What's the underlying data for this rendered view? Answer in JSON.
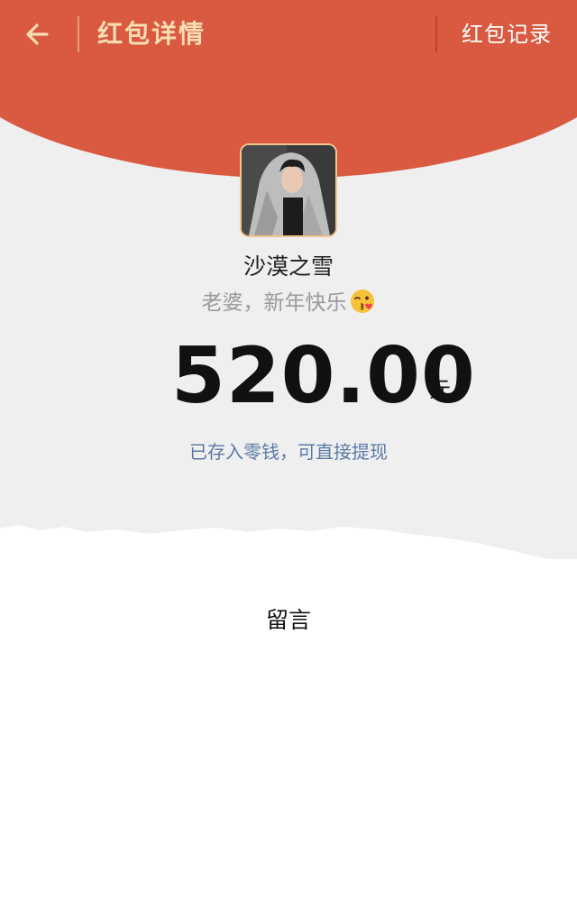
{
  "header": {
    "back_icon": "arrow-left-icon",
    "title": "红包详情",
    "records_label": "红包记录"
  },
  "sender": {
    "name": "沙漠之雪",
    "greeting": "老婆，新年快乐",
    "greeting_emoji": "kissing-face-wink-icon"
  },
  "amount": {
    "value": "520.00",
    "currency": "元"
  },
  "storage_note": "已存入零钱，可直接提现",
  "comment": {
    "label": "留言"
  },
  "colors": {
    "header_red": "#d95a40",
    "title_gold": "#f8ddb2",
    "link_blue": "#5b7aa6",
    "upper_bg": "#efefef",
    "avatar_border": "#f0c58d"
  }
}
